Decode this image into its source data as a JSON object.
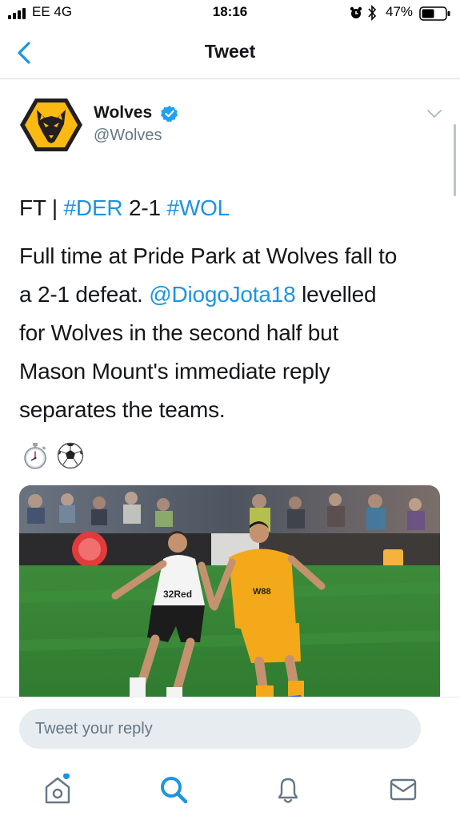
{
  "status_bar": {
    "carrier": "EE  4G",
    "time": "18:16",
    "battery": "47%"
  },
  "nav": {
    "title": "Tweet",
    "back_icon": "chevron-left-icon"
  },
  "tweet": {
    "author_name": "Wolves",
    "author_handle": "@Wolves",
    "line1": {
      "prefix": "FT | ",
      "hashtag1": "#DER",
      "score": " 2-1 ",
      "hashtag2": "#WOL"
    },
    "body": {
      "line1": "Full time at Pride Park at Wolves fall to",
      "line2_prefix": "a 2-1 defeat. ",
      "mention": "@DiogoJota18",
      "line2_suffix": " levelled",
      "line3": "for Wolves in the second half but",
      "line4": "Mason Mount's immediate reply",
      "line5": "separates the teams."
    },
    "emojis": [
      "stopwatch-icon",
      "soccer-ball-icon"
    ],
    "media_shirt_text": "32Red",
    "media_sponsor_text": "W88"
  },
  "reply": {
    "placeholder": "Tweet your reply"
  },
  "tabs": [
    {
      "name": "home",
      "icon": "home-icon",
      "active": false,
      "has_dot": true
    },
    {
      "name": "search",
      "icon": "search-icon",
      "active": true
    },
    {
      "name": "notifications",
      "icon": "bell-icon",
      "active": false
    },
    {
      "name": "messages",
      "icon": "mail-icon",
      "active": false
    }
  ],
  "colors": {
    "accent": "#1b95e0",
    "wolves_gold": "#fdb913",
    "text": "#14171a",
    "secondary_text": "#657786"
  }
}
